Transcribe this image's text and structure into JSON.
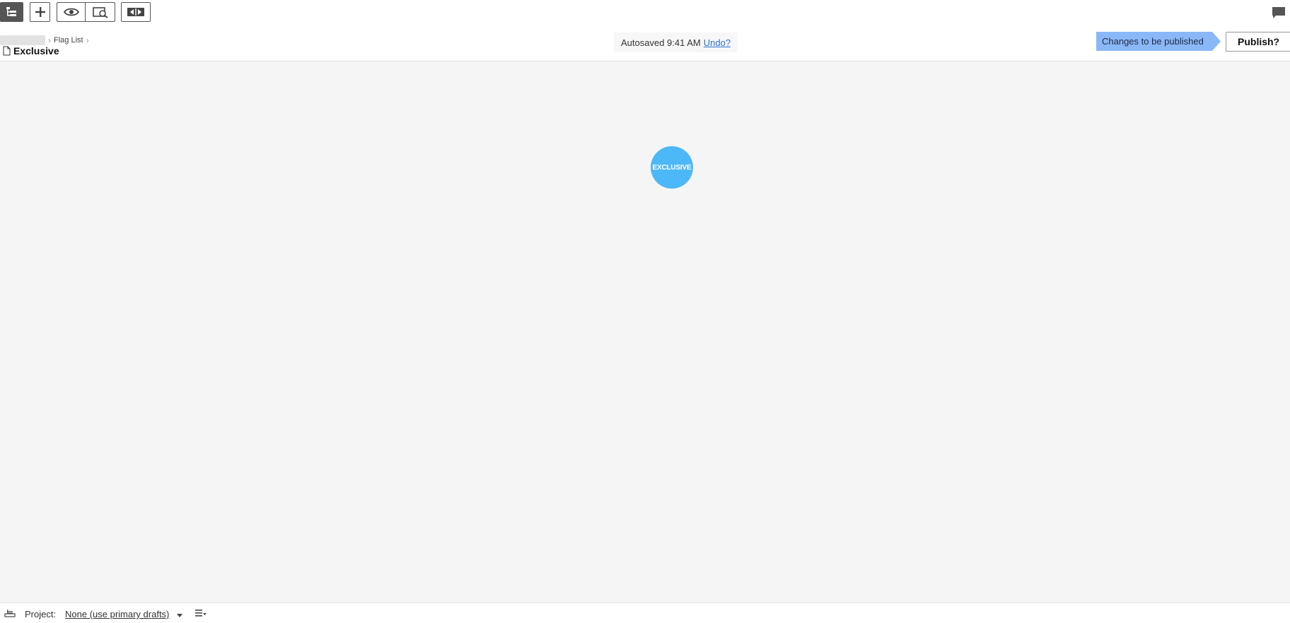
{
  "toolbar": {
    "buttons": [
      {
        "name": "tree-view-icon",
        "active": true
      },
      {
        "name": "plus-icon",
        "active": false
      },
      {
        "name": "eye-icon",
        "active": false
      },
      {
        "name": "preview-search-icon",
        "active": false
      },
      {
        "name": "compare-arrows-icon",
        "active": false
      }
    ],
    "chat_icon": "comment-icon"
  },
  "header": {
    "breadcrumb": {
      "parent": "Flag List"
    },
    "title": "Exclusive",
    "autosave_text": "Autosaved 9:41 AM",
    "undo_label": "Undo?",
    "status_badge": "Changes to be published",
    "publish_label": "Publish?"
  },
  "canvas": {
    "flag_label": "EXCLUSIVE",
    "flag_color": "#4db8f7"
  },
  "footer": {
    "project_label": "Project:",
    "project_value": "None (use primary drafts)"
  },
  "colors": {
    "accent_badge": "#8ab8f7",
    "link": "#2b6fd6",
    "canvas_bg": "#f5f5f5"
  }
}
